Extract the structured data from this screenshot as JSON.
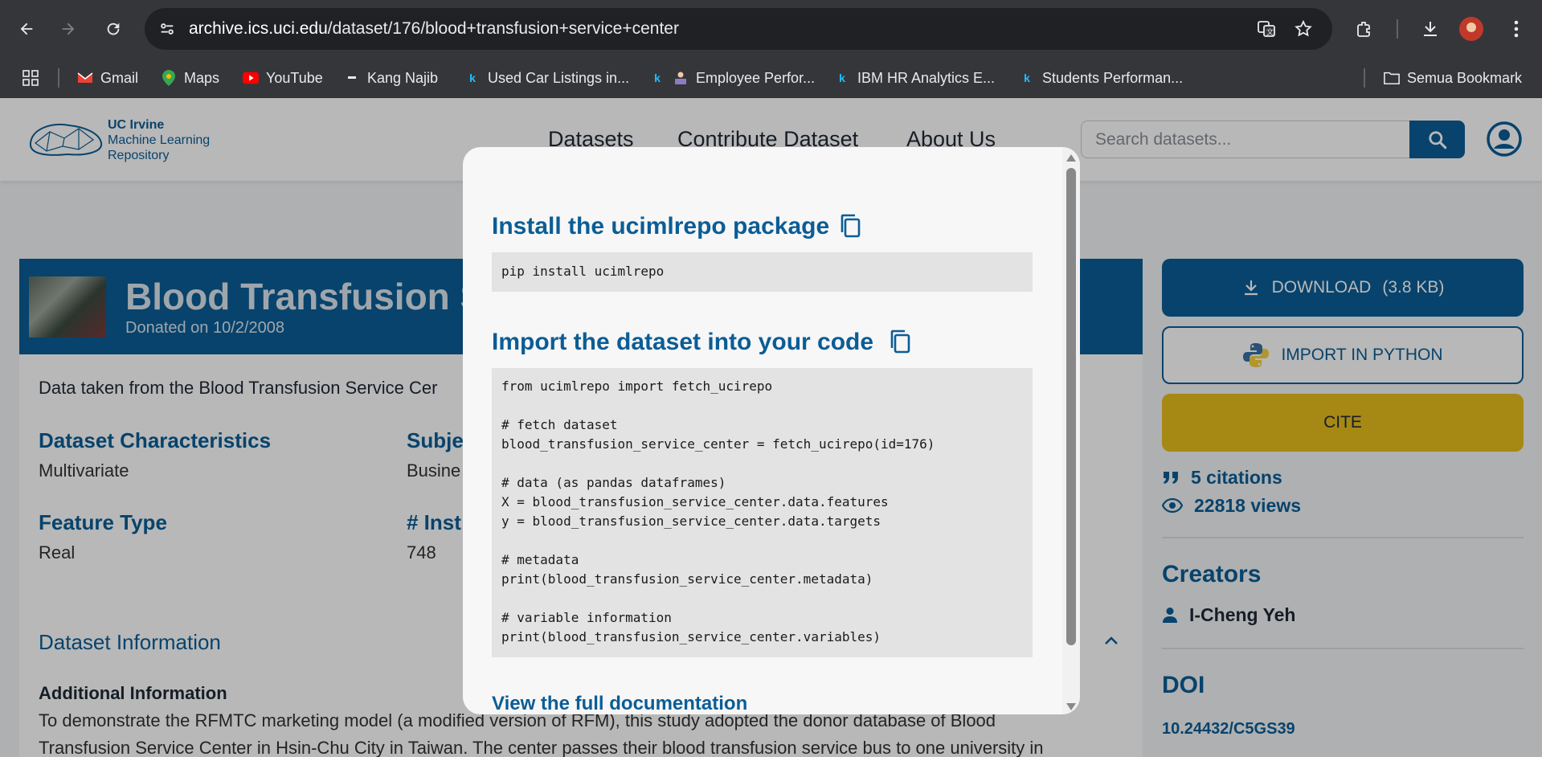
{
  "browser": {
    "url_host": "archive.ics.uci.edu",
    "url_path": "/dataset/176/blood+transfusion+service+center",
    "bookmarks": [
      {
        "label": "Gmail",
        "icon": "gmail-icon"
      },
      {
        "label": "Maps",
        "icon": "maps-icon"
      },
      {
        "label": "YouTube",
        "icon": "youtube-icon"
      },
      {
        "label": "Kang Najib",
        "icon": "dash-icon"
      },
      {
        "label": "Used Car Listings in...",
        "icon": "kaggle-icon"
      },
      {
        "label": "Employee Perfor...",
        "icon": "kaggle-icon"
      },
      {
        "label": "IBM HR Analytics E...",
        "icon": "kaggle-icon"
      },
      {
        "label": "Students Performan...",
        "icon": "kaggle-icon"
      }
    ],
    "all_bookmarks": "Semua Bookmark"
  },
  "site": {
    "logo_line1": "UC Irvine",
    "logo_line2": "Machine Learning",
    "logo_line3": "Repository",
    "nav": [
      "Datasets",
      "Contribute Dataset",
      "About Us"
    ],
    "search_placeholder": "Search datasets..."
  },
  "dataset": {
    "title": "Blood Transfusion Se",
    "donated": "Donated on 10/2/2008",
    "summary": "Data taken from the Blood Transfusion Service Cer",
    "characteristics_label": "Dataset Characteristics",
    "characteristics_value": "Multivariate",
    "subject_label": "Subje",
    "subject_value": "Busine",
    "feature_type_label": "Feature Type",
    "feature_type_value": "Real",
    "instances_label": "# Inst",
    "instances_value": "748",
    "info_title": "Dataset Information",
    "additional_info_label": "Additional Information",
    "additional_info_line1": "To demonstrate the RFMTC marketing model (a modified version of RFM), this study adopted the donor database of Blood",
    "additional_info_line2": "Transfusion Service Center in Hsin-Chu City in Taiwan. The center passes their blood transfusion service bus to one university in"
  },
  "sidebar": {
    "download_label": "DOWNLOAD",
    "download_size": "(3.8 KB)",
    "import_label": "IMPORT IN PYTHON",
    "cite_label": "CITE",
    "citations": "5 citations",
    "views": "22818 views",
    "creators_title": "Creators",
    "creator_name": "I-Cheng Yeh",
    "doi_title": "DOI",
    "doi_value": "10.24432/C5GS39"
  },
  "modal": {
    "install_title": "Install the ucimlrepo package",
    "install_code": [
      "pip install ucimlrepo"
    ],
    "import_title": "Import the dataset into your code",
    "import_code": [
      "from ucimlrepo import fetch_ucirepo",
      "",
      "# fetch dataset",
      "blood_transfusion_service_center = fetch_ucirepo(id=176)",
      "",
      "# data (as pandas dataframes)",
      "X = blood_transfusion_service_center.data.features",
      "y = blood_transfusion_service_center.data.targets",
      "",
      "# metadata",
      "print(blood_transfusion_service_center.metadata)",
      "",
      "# variable information",
      "print(blood_transfusion_service_center.variables)"
    ],
    "doc_link": "View the full documentation"
  },
  "colors": {
    "brand_blue": "#0b5d96",
    "cite_yellow": "#e6bd1c",
    "chrome_dark": "#35363a"
  }
}
